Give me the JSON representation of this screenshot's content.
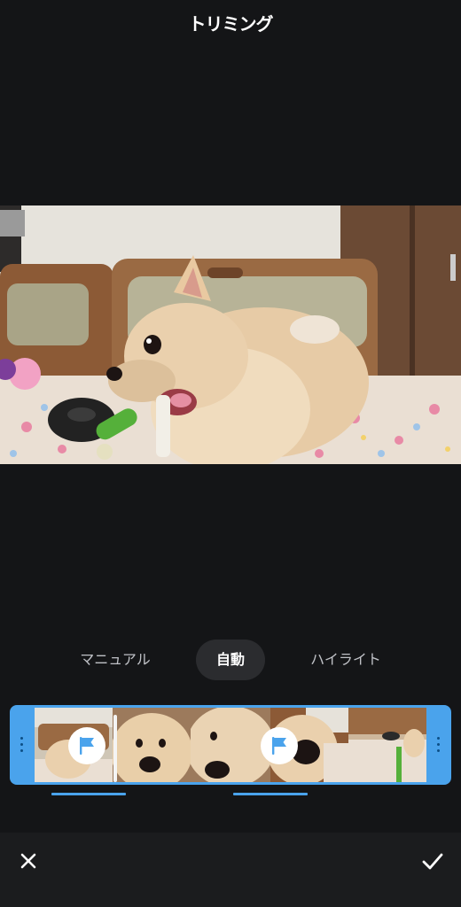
{
  "header": {
    "title": "トリミング"
  },
  "preview": {
    "content": "video-frame-dog"
  },
  "mode_tabs": {
    "manual": "マニュアル",
    "auto": "自動",
    "highlight": "ハイライト",
    "selected": "auto"
  },
  "timeline": {
    "accent_color": "#4aa3ec",
    "frame_count": 5,
    "markers": [
      "flag-icon",
      "flag-icon"
    ]
  },
  "bottom_bar": {
    "close_icon": "close-icon",
    "confirm_icon": "check-icon"
  }
}
